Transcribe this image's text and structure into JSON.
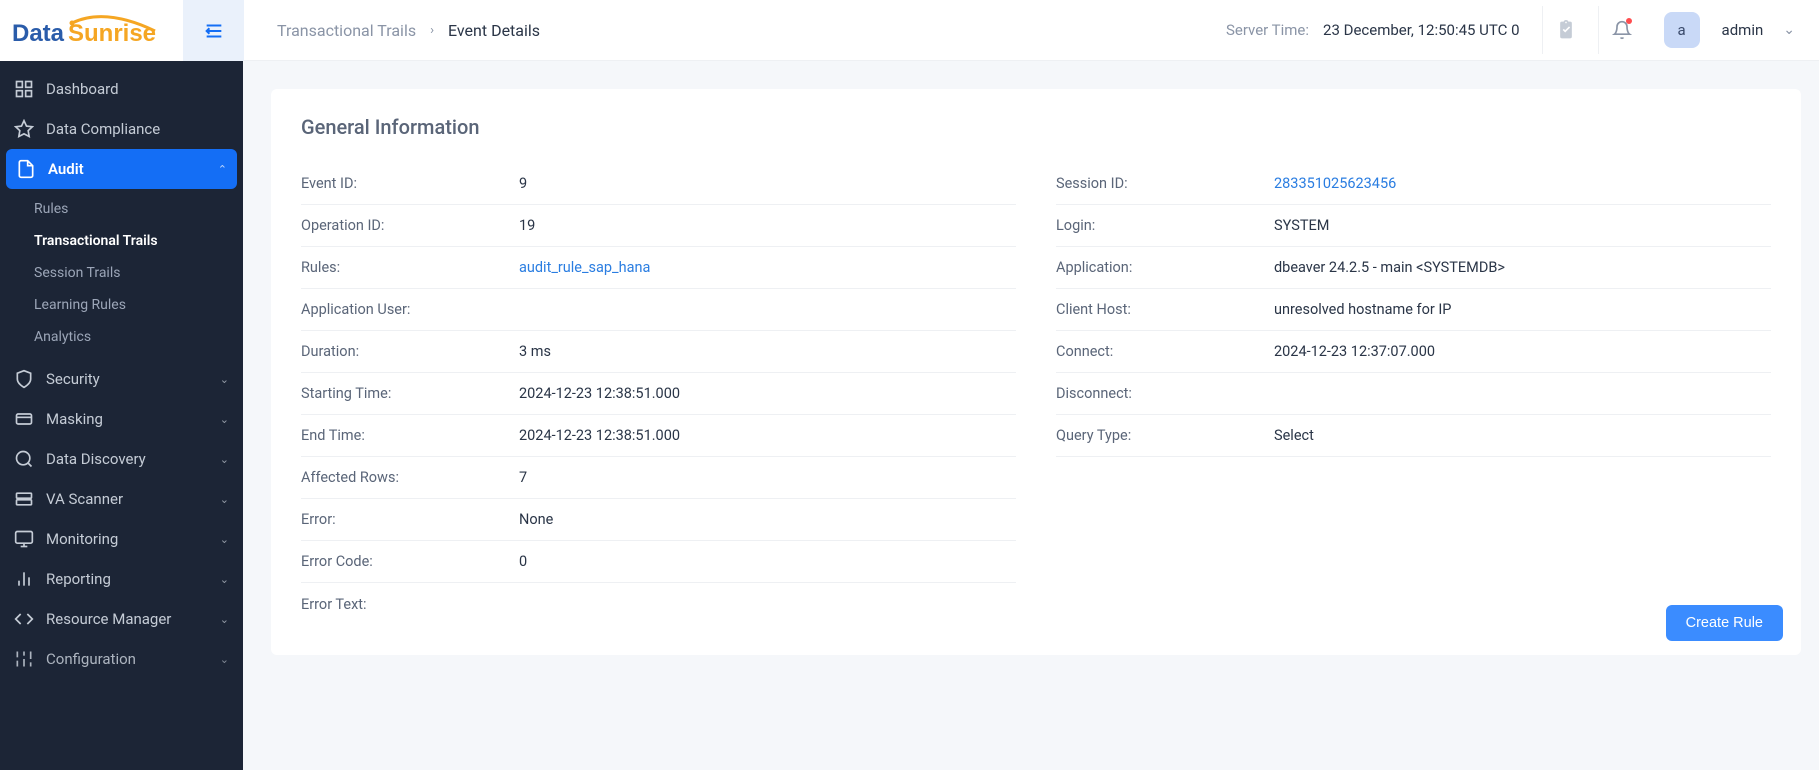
{
  "logo": {
    "part1": "Data",
    "part2": "Sunrise"
  },
  "breadcrumb": {
    "parent": "Transactional Trails",
    "current": "Event Details"
  },
  "serverTime": {
    "label": "Server Time:",
    "value": "23 December, 12:50:45  UTC 0"
  },
  "user": {
    "initial": "a",
    "name": "admin"
  },
  "sidebar": {
    "items": [
      {
        "label": "Dashboard"
      },
      {
        "label": "Data Compliance"
      },
      {
        "label": "Audit"
      },
      {
        "label": "Security"
      },
      {
        "label": "Masking"
      },
      {
        "label": "Data Discovery"
      },
      {
        "label": "VA Scanner"
      },
      {
        "label": "Monitoring"
      },
      {
        "label": "Reporting"
      },
      {
        "label": "Resource Manager"
      },
      {
        "label": "Configuration"
      }
    ],
    "auditSub": [
      {
        "label": "Rules"
      },
      {
        "label": "Transactional Trails"
      },
      {
        "label": "Session Trails"
      },
      {
        "label": "Learning Rules"
      },
      {
        "label": "Analytics"
      }
    ]
  },
  "section": {
    "title": "General Information"
  },
  "left": [
    {
      "label": "Event ID:",
      "value": "9"
    },
    {
      "label": "Operation ID:",
      "value": "19"
    },
    {
      "label": "Rules:",
      "value": "audit_rule_sap_hana",
      "link": true
    },
    {
      "label": "Application User:",
      "value": ""
    },
    {
      "label": "Duration:",
      "value": "3 ms"
    },
    {
      "label": "Starting Time:",
      "value": "2024-12-23 12:38:51.000"
    },
    {
      "label": "End Time:",
      "value": "2024-12-23 12:38:51.000"
    },
    {
      "label": "Affected Rows:",
      "value": "7"
    },
    {
      "label": "Error:",
      "value": "None"
    },
    {
      "label": "Error Code:",
      "value": "0"
    },
    {
      "label": "Error Text:",
      "value": ""
    }
  ],
  "right": [
    {
      "label": "Session ID:",
      "value": "283351025623456",
      "link": true
    },
    {
      "label": "Login:",
      "value": "SYSTEM"
    },
    {
      "label": "Application:",
      "value": "dbeaver 24.2.5 - main <SYSTEMDB>"
    },
    {
      "label": "Client Host:",
      "value": "unresolved hostname for IP"
    },
    {
      "label": "Connect:",
      "value": "2024-12-23 12:37:07.000"
    },
    {
      "label": "Disconnect:",
      "value": ""
    },
    {
      "label": "Query Type:",
      "value": "Select"
    }
  ],
  "buttons": {
    "createRule": "Create Rule"
  }
}
